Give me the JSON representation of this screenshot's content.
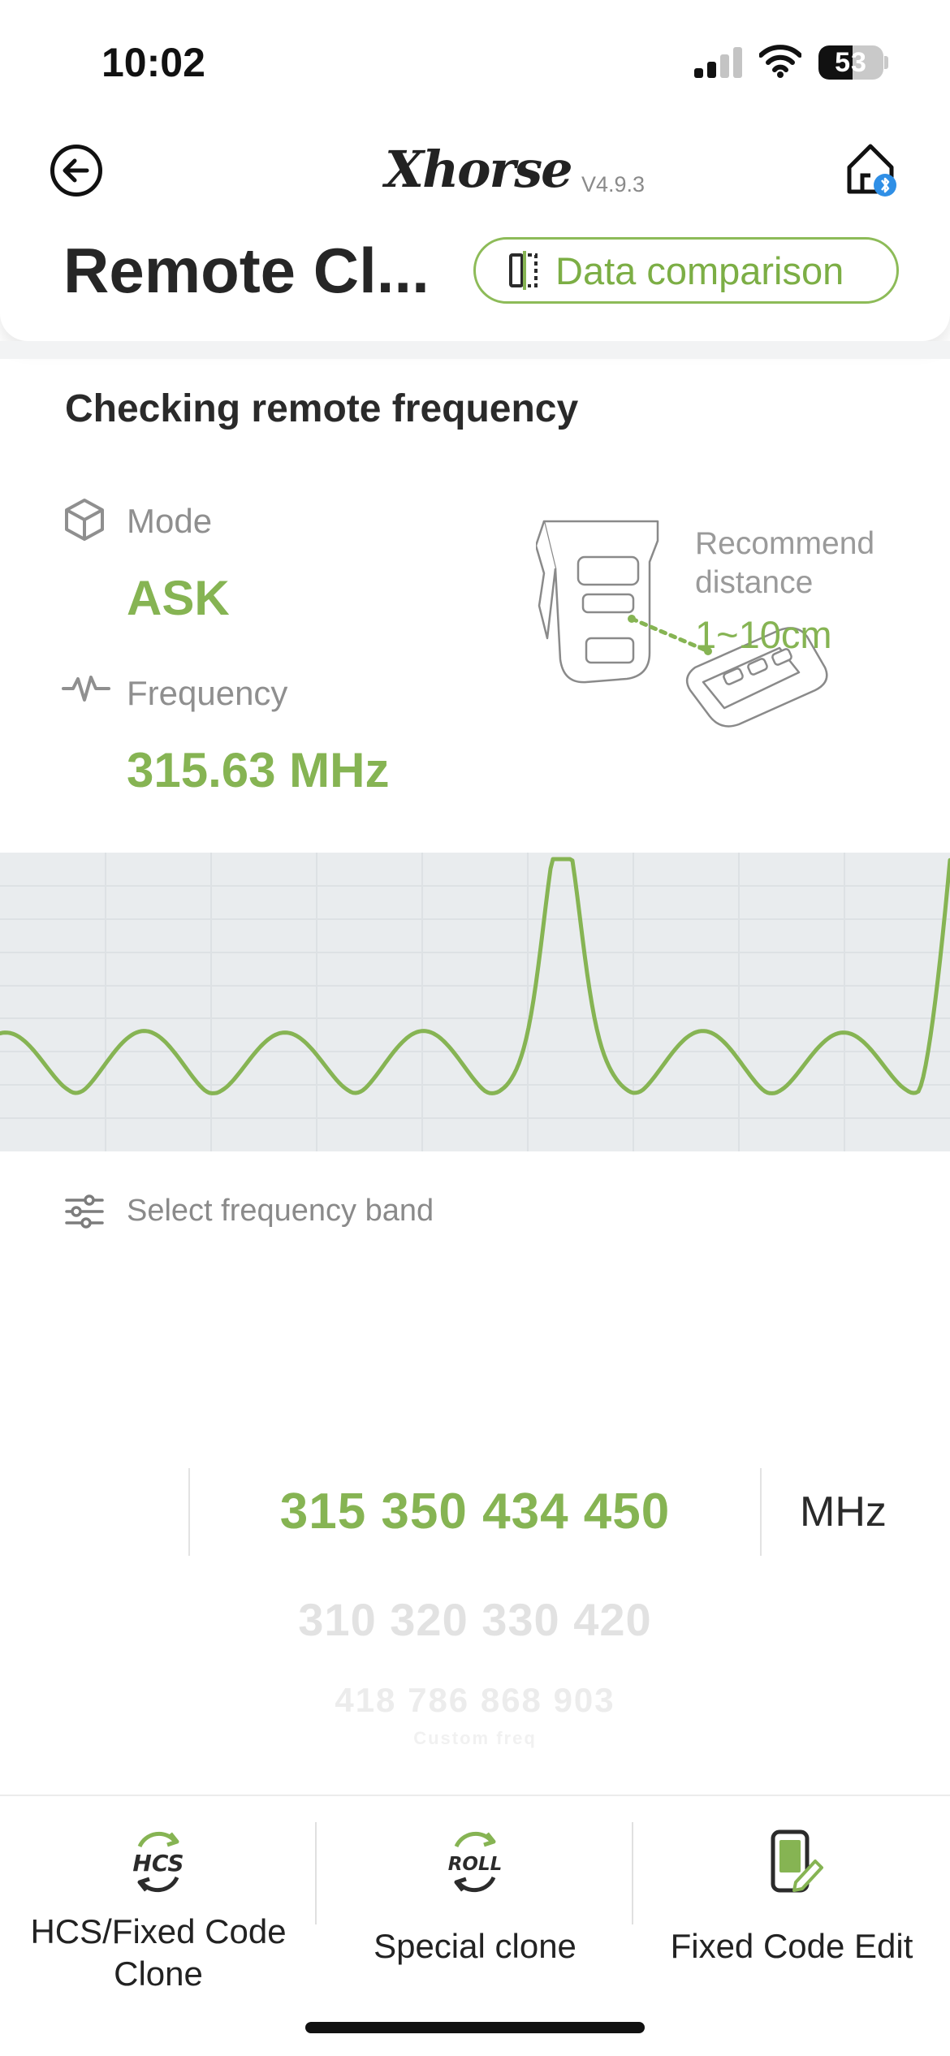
{
  "status_bar": {
    "time": "10:02",
    "battery_percent": "53",
    "battery_level": 0.53,
    "icons": [
      "signal-icon",
      "wifi-icon",
      "battery-icon"
    ]
  },
  "header": {
    "back_icon": "back-arrow-icon",
    "logo_text": "Xhorse",
    "version": "V4.9.3",
    "home_icon": "home-bluetooth-icon",
    "title": "Remote Cl...",
    "compare_button": {
      "label": "Data comparison",
      "icon": "compare-icon"
    }
  },
  "check": {
    "title": "Checking remote frequency",
    "mode": {
      "label": "Mode",
      "value": "ASK",
      "icon": "cube-icon"
    },
    "frequency": {
      "label": "Frequency",
      "value": "315.63 MHz",
      "icon": "waveform-icon"
    },
    "recommend": {
      "label": "Recommend distance",
      "value": "1~10cm",
      "illustration": "device-and-remote-illustration"
    }
  },
  "spectrum": {
    "line_color": "#86b453",
    "background": "#e9ecee"
  },
  "band_picker": {
    "icon": "sliders-icon",
    "label": "Select frequency band",
    "rows": [
      "315 350 434 450",
      "310 320 330 420",
      "418 786 868 903",
      "Custom freq"
    ],
    "selected_index": 0,
    "unit": "MHz"
  },
  "tabs": [
    {
      "label": "HCS/Fixed Code Clone",
      "icon": "hcs-icon",
      "icon_text": "HCS"
    },
    {
      "label": "Special clone",
      "icon": "roll-icon",
      "icon_text": "ROLL"
    },
    {
      "label": "Fixed Code Edit",
      "icon": "phone-edit-icon"
    }
  ],
  "colors": {
    "accent_green": "#86b453",
    "text_dark": "#262626",
    "text_muted": "#8f8f8f"
  }
}
